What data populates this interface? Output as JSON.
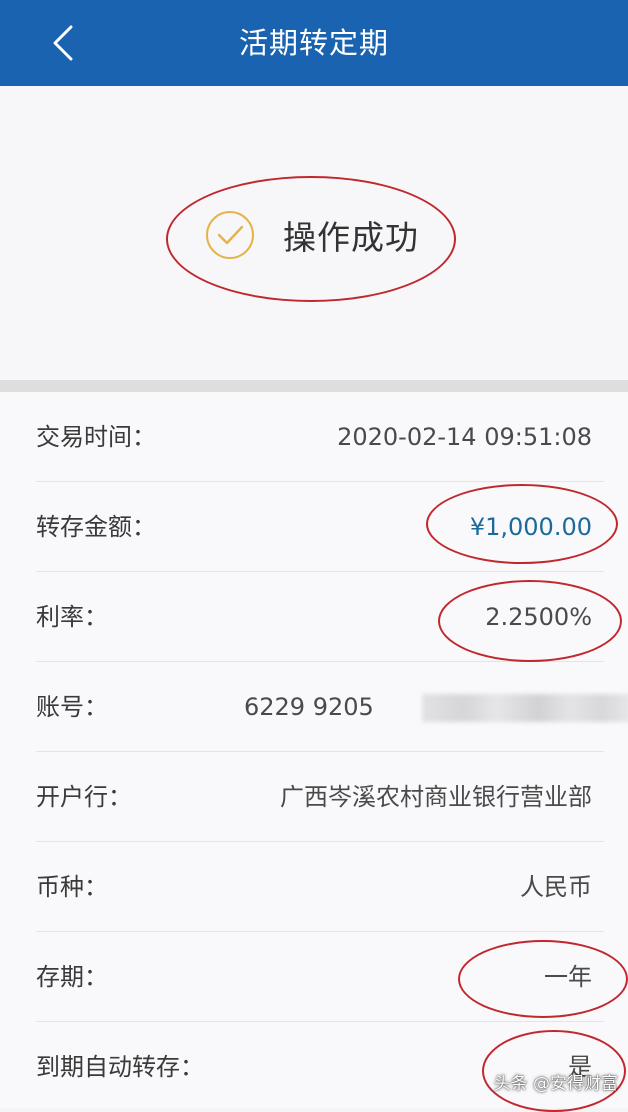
{
  "nav": {
    "title": "活期转定期"
  },
  "status": {
    "text": "操作成功"
  },
  "details": [
    {
      "label": "交易时间：",
      "value": "2020-02-14 09:51:08"
    },
    {
      "label": "转存金额：",
      "value": "¥1,000.00"
    },
    {
      "label": "利率：",
      "value": "2.2500%"
    },
    {
      "label": "账号：",
      "value": "6229 9205"
    },
    {
      "label": "开户行：",
      "value": "广西岑溪农村商业银行营业部"
    },
    {
      "label": "币种：",
      "value": "人民币"
    },
    {
      "label": "存期：",
      "value": "一年"
    },
    {
      "label": "到期自动转存：",
      "value": "是"
    }
  ],
  "watermark": "头条 @安得财富",
  "colors": {
    "nav_bg": "#1a63b0",
    "check": "#e6b34a",
    "amount": "#1a6a9a",
    "annotation": "#c0282e"
  }
}
